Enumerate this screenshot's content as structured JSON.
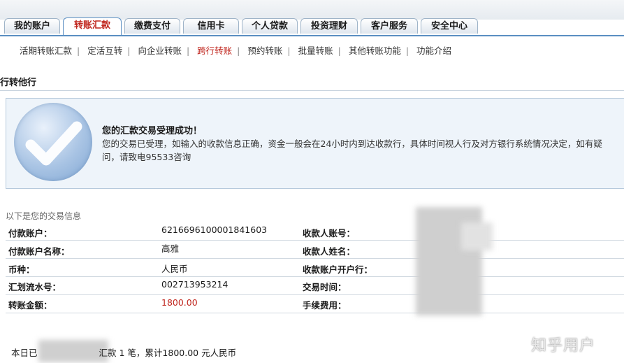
{
  "tabs": [
    "我的账户",
    "转账汇款",
    "缴费支付",
    "信用卡",
    "个人贷款",
    "投资理财",
    "客户服务",
    "安全中心"
  ],
  "active_tab": 1,
  "subnav": [
    "活期转账汇款",
    "定活互转",
    "向企业转账",
    "跨行转账",
    "预约转账",
    "批量转账",
    "其他转账功能",
    "功能介绍"
  ],
  "active_subnav": 3,
  "section_title": "建行转他行",
  "success": {
    "title": "您的汇款交易受理成功！",
    "message": "您的交易已受理，如输入的收款信息正确，资金一般会在24小时内到达收款行，具体时间视人行及对方银行系统情况决定，如有疑问，请致电95533咨询"
  },
  "info_title": "以下是您的交易信息",
  "rows": [
    {
      "left_label": "付款账户：",
      "left_value": "6216696100001841603",
      "right_label": "收款人账号："
    },
    {
      "left_label": "付款账户名称：",
      "left_value": "高雅",
      "right_label": "收款人姓名："
    },
    {
      "left_label": "币种：",
      "left_value": "人民币",
      "right_label": "收款账户开户行："
    },
    {
      "left_label": "汇划流水号：",
      "left_value": "002713953214",
      "right_label": "交易时间："
    },
    {
      "left_label": "转账金额：",
      "left_value": "1800.00",
      "right_label": "手续费用："
    }
  ],
  "footer": {
    "prefix": "本日已",
    "suffix": "汇款 1 笔，累计1800.00 元人民币"
  },
  "watermark": "知乎用户",
  "colors": {
    "accent_red": "#c0261e",
    "tab_border": "#5b8fc2",
    "success_bg": "#eef4fa"
  },
  "icons": {
    "success": "checkmark-circle-icon"
  }
}
